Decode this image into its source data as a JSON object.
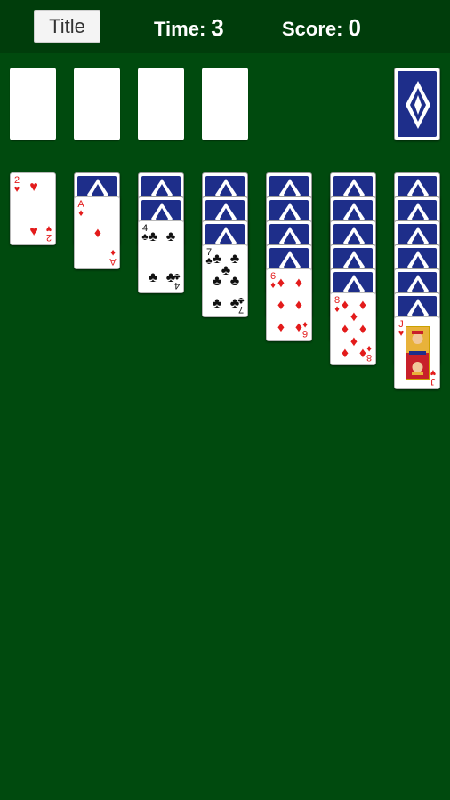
{
  "header": {
    "title_button": "Title",
    "time_label": "Time:",
    "time_value": "3",
    "score_label": "Score:",
    "score_value": "0"
  },
  "colors": {
    "table_green": "#004a0e",
    "header_green": "#003d0b",
    "card_back_blue": "#1e2e8a",
    "red_suit": "#e31b1b",
    "black_suit": "#111111"
  },
  "suits": {
    "hearts": "♥",
    "diamonds": "♦",
    "clubs": "♣"
  },
  "tableau": [
    {
      "face_down": 0,
      "rank": "2",
      "suit": "hearts"
    },
    {
      "face_down": 1,
      "rank": "A",
      "suit": "diamonds"
    },
    {
      "face_down": 2,
      "rank": "4",
      "suit": "clubs"
    },
    {
      "face_down": 3,
      "rank": "7",
      "suit": "clubs"
    },
    {
      "face_down": 4,
      "rank": "6",
      "suit": "diamonds"
    },
    {
      "face_down": 5,
      "rank": "8",
      "suit": "diamonds"
    },
    {
      "face_down": 6,
      "rank": "J",
      "suit": "hearts"
    }
  ]
}
